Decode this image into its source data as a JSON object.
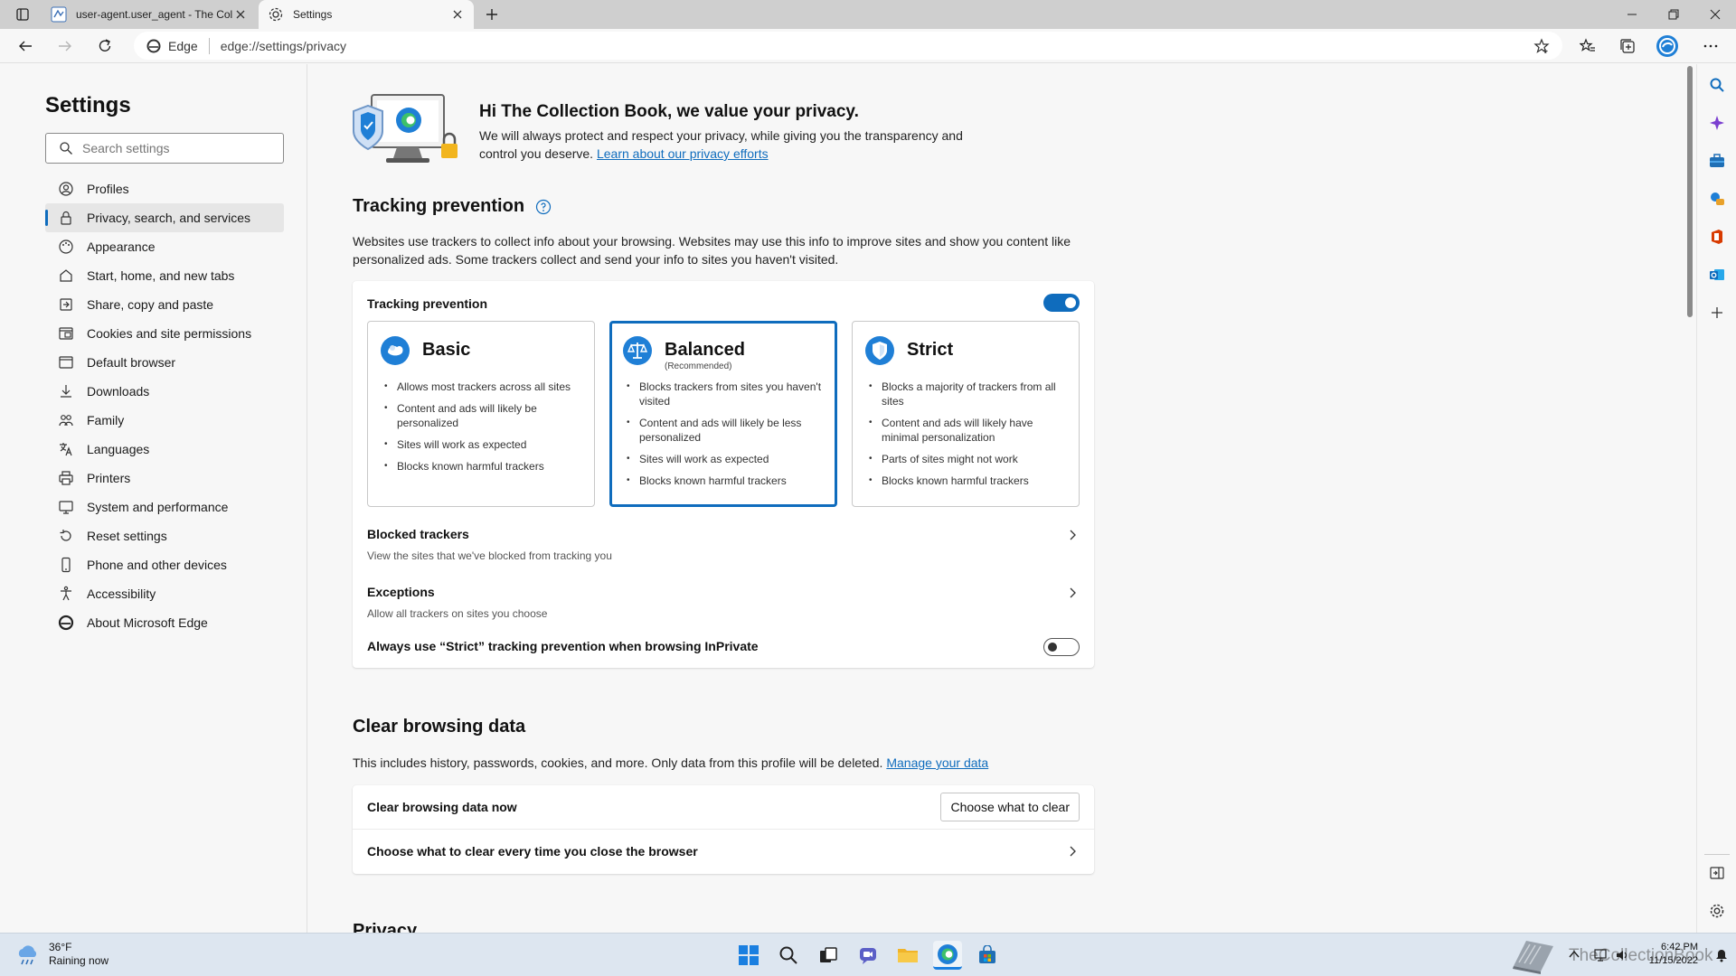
{
  "browser": {
    "tabs": [
      {
        "title": "user-agent.user_agent - The Coll"
      },
      {
        "title": "Settings"
      }
    ],
    "address": {
      "identity": "Edge",
      "url": "edge://settings/privacy"
    }
  },
  "sidebar": {
    "title": "Settings",
    "search_placeholder": "Search settings",
    "items": [
      {
        "label": "Profiles",
        "icon": "profile-icon"
      },
      {
        "label": "Privacy, search, and services",
        "icon": "lock-icon"
      },
      {
        "label": "Appearance",
        "icon": "appearance-icon"
      },
      {
        "label": "Start, home, and new tabs",
        "icon": "home-tabs-icon"
      },
      {
        "label": "Share, copy and paste",
        "icon": "share-icon"
      },
      {
        "label": "Cookies and site permissions",
        "icon": "cookies-icon"
      },
      {
        "label": "Default browser",
        "icon": "browser-icon"
      },
      {
        "label": "Downloads",
        "icon": "download-icon"
      },
      {
        "label": "Family",
        "icon": "family-icon"
      },
      {
        "label": "Languages",
        "icon": "languages-icon"
      },
      {
        "label": "Printers",
        "icon": "printer-icon"
      },
      {
        "label": "System and performance",
        "icon": "system-icon"
      },
      {
        "label": "Reset settings",
        "icon": "reset-icon"
      },
      {
        "label": "Phone and other devices",
        "icon": "phone-icon"
      },
      {
        "label": "Accessibility",
        "icon": "accessibility-icon"
      },
      {
        "label": "About Microsoft Edge",
        "icon": "edge-logo-icon"
      }
    ]
  },
  "hero": {
    "title": "Hi The Collection Book, we value your privacy.",
    "text": "We will always protect and respect your privacy, while giving you the transparency and control you deserve.",
    "link": "Learn about our privacy efforts"
  },
  "tracking": {
    "section_title": "Tracking prevention",
    "description": "Websites use trackers to collect info about your browsing. Websites may use this info to improve sites and show you content like personalized ads. Some trackers collect and send your info to sites you haven't visited.",
    "toggle_label": "Tracking prevention",
    "toggle_on": true,
    "modes": [
      {
        "name": "Basic",
        "note": "",
        "bullets": [
          "Allows most trackers across all sites",
          "Content and ads will likely be personalized",
          "Sites will work as expected",
          "Blocks known harmful trackers"
        ]
      },
      {
        "name": "Balanced",
        "note": "(Recommended)",
        "bullets": [
          "Blocks trackers from sites you haven't visited",
          "Content and ads will likely be less personalized",
          "Sites will work as expected",
          "Blocks known harmful trackers"
        ]
      },
      {
        "name": "Strict",
        "note": "",
        "bullets": [
          "Blocks a majority of trackers from all sites",
          "Content and ads will likely have minimal personalization",
          "Parts of sites might not work",
          "Blocks known harmful trackers"
        ]
      }
    ],
    "selected_mode": "Balanced",
    "blocked_trackers": {
      "title": "Blocked trackers",
      "sub": "View the sites that we've blocked from tracking you"
    },
    "exceptions": {
      "title": "Exceptions",
      "sub": "Allow all trackers on sites you choose"
    },
    "inprivate": {
      "label": "Always use “Strict” tracking prevention when browsing InPrivate",
      "on": false
    }
  },
  "clear": {
    "section_title": "Clear browsing data",
    "description": "This includes history, passwords, cookies, and more. Only data from this profile will be deleted.",
    "link": "Manage your data",
    "now_label": "Clear browsing data now",
    "button": "Choose what to clear",
    "on_close_label": "Choose what to clear every time you close the browser"
  },
  "next_section_title": "Privacy",
  "taskbar": {
    "weather_temp": "36°F",
    "weather_desc": "Raining now",
    "time": "6:42 PM",
    "date": "11/15/2022",
    "watermark": "TheCollectionBook"
  },
  "colors": {
    "accent": "#0f6cbd",
    "taskbar": "#dde6f0"
  }
}
